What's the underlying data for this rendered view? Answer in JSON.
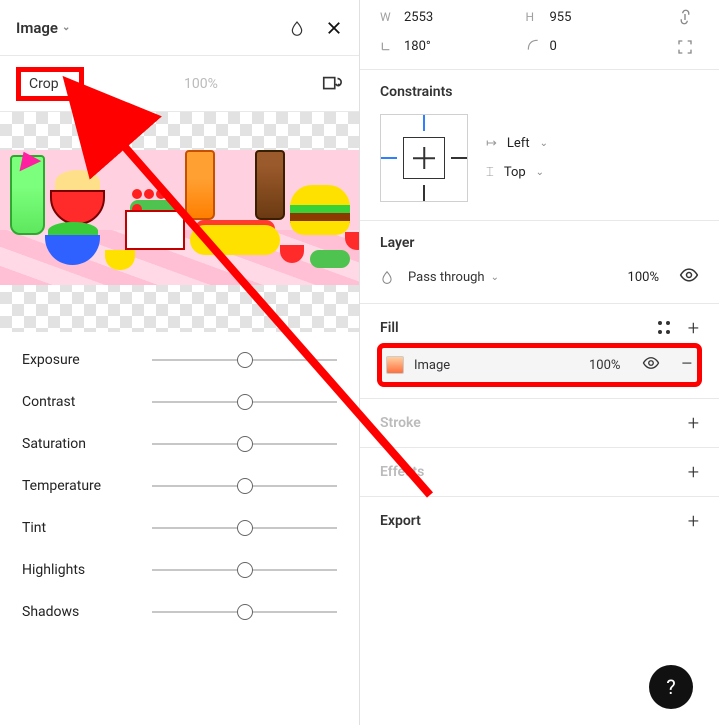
{
  "header": {
    "title": "Image"
  },
  "crop": {
    "label": "Crop",
    "zoom": "100%"
  },
  "sliders": [
    {
      "label": "Exposure"
    },
    {
      "label": "Contrast"
    },
    {
      "label": "Saturation"
    },
    {
      "label": "Temperature"
    },
    {
      "label": "Tint"
    },
    {
      "label": "Highlights"
    },
    {
      "label": "Shadows"
    }
  ],
  "dims": {
    "w_label": "W",
    "w": "2553",
    "h_label": "H",
    "h": "955",
    "angle_label": "⌐",
    "angle": "180°",
    "radius_label": "⌐",
    "radius": "0"
  },
  "constraints": {
    "title": "Constraints",
    "horizontal": "Left",
    "vertical": "Top"
  },
  "layer": {
    "title": "Layer",
    "blend": "Pass through",
    "opacity": "100%"
  },
  "fill": {
    "title": "Fill",
    "item_label": "Image",
    "item_opacity": "100%"
  },
  "stroke": {
    "title": "Stroke"
  },
  "effects": {
    "title": "Effects"
  },
  "export": {
    "title": "Export"
  },
  "help": "?"
}
